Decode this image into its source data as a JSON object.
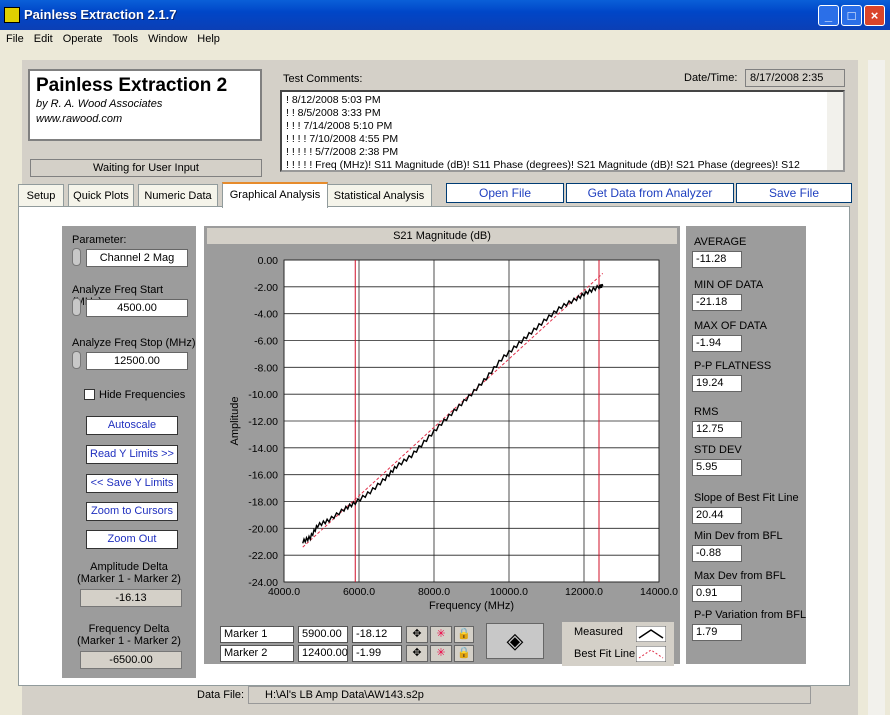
{
  "window": {
    "title": "Painless Extraction 2.1.7"
  },
  "menu": [
    "File",
    "Edit",
    "Operate",
    "Tools",
    "Window",
    "Help"
  ],
  "logo": {
    "title": "Painless Extraction 2",
    "line1": "by R. A. Wood Associates",
    "line2": "www.rawood.com"
  },
  "status": "Waiting for User Input",
  "comments": {
    "label": "Test Comments:",
    "lines": [
      "! 8/12/2008 5:03 PM",
      "! ! 8/5/2008 3:33 PM",
      "! ! ! 7/14/2008 5:10 PM",
      "! ! ! ! 7/10/2008 4:55 PM",
      "! ! ! ! ! 5/7/2008 2:38 PM",
      "! ! ! ! ! Freq (MHz)! S11 Magnitude (dB)! S11 Phase (degrees)! S21 Magnitude (dB)! S21 Phase (degrees)! S12"
    ]
  },
  "datetime": {
    "label": "Date/Time:",
    "value": "8/17/2008  2:35"
  },
  "tabs": [
    "Setup",
    "Quick Plots",
    "Numeric Data",
    "Graphical Analysis",
    "Statistical Analysis"
  ],
  "actions": {
    "open": "Open File",
    "get": "Get Data from Analyzer",
    "save": "Save File"
  },
  "left": {
    "param_label": "Parameter:",
    "param_value": "Channel 2 Mag",
    "start_label": "Analyze Freq Start (MHz)",
    "start_value": "4500.00",
    "stop_label": "Analyze Freq Stop (MHz)",
    "stop_value": "12500.00",
    "hide_label": "Hide Frequencies",
    "autoscale": "Autoscale",
    "read_y": "Read Y Limits >>",
    "save_y": "<< Save Y Limits",
    "zoom_cursors": "Zoom to Cursors",
    "zoom_out": "Zoom Out",
    "amp_delta_label1": "Amplitude Delta",
    "amp_delta_label2": "(Marker 1 - Marker 2)",
    "amp_delta": "-16.13",
    "freq_delta_label1": "Frequency Delta",
    "freq_delta_label2": "(Marker 1 - Marker 2)",
    "freq_delta": "-6500.00"
  },
  "stats": [
    {
      "label": "AVERAGE",
      "value": "-11.28"
    },
    {
      "label": "MIN OF DATA",
      "value": "-21.18"
    },
    {
      "label": "MAX OF DATA",
      "value": "-1.94"
    },
    {
      "label": "P-P FLATNESS",
      "value": "19.24"
    },
    {
      "label": "RMS",
      "value": "12.75"
    },
    {
      "label": "STD DEV",
      "value": "5.95"
    },
    {
      "label": "Slope of Best Fit Line",
      "value": "20.44"
    },
    {
      "label": "Min Dev from BFL",
      "value": "-0.88"
    },
    {
      "label": "Max Dev from BFL",
      "value": "0.91"
    },
    {
      "label": "P-P Variation from BFL",
      "value": "1.79"
    }
  ],
  "markers": [
    {
      "name": "Marker 1",
      "freq": "5900.00",
      "amp": "-18.12"
    },
    {
      "name": "Marker 2",
      "freq": "12400.00",
      "amp": "-1.99"
    }
  ],
  "legend": {
    "measured": "Measured",
    "bfl": "Best Fit Line"
  },
  "datafile": {
    "label": "Data File:",
    "value": "H:\\Al's LB Amp Data\\AW143.s2p"
  },
  "chart_data": {
    "type": "line",
    "title": "S21 Magnitude (dB)",
    "xlabel": "Frequency (MHz)",
    "ylabel": "Amplitude",
    "xlim": [
      4000,
      14000
    ],
    "ylim": [
      -24,
      0
    ],
    "xticks": [
      "4000.0",
      "6000.0",
      "8000.0",
      "10000.0",
      "12000.0",
      "14000.0"
    ],
    "yticks": [
      "0.00",
      "-2.00",
      "-4.00",
      "-6.00",
      "-8.00",
      "-10.00",
      "-12.00",
      "-14.00",
      "-16.00",
      "-18.00",
      "-20.00",
      "-22.00",
      "-24.00"
    ],
    "cursors_x": [
      5900,
      12400
    ],
    "series": [
      {
        "name": "Measured",
        "color": "#000000",
        "x": [
          4500,
          4700,
          4900,
          5200,
          5600,
          5900,
          6300,
          6700,
          7000,
          7400,
          7800,
          8200,
          8600,
          9000,
          9400,
          9800,
          10200,
          10600,
          11000,
          11400,
          11800,
          12100,
          12400,
          12500
        ],
        "y": [
          -21.0,
          -20.7,
          -19.8,
          -19.4,
          -18.6,
          -18.1,
          -17.3,
          -16.3,
          -15.4,
          -14.6,
          -13.4,
          -12.2,
          -11.1,
          -10.0,
          -8.8,
          -7.4,
          -6.4,
          -5.4,
          -4.4,
          -3.5,
          -2.9,
          -2.4,
          -2.0,
          -1.94
        ]
      },
      {
        "name": "Best Fit Line",
        "color": "#e0304a",
        "x": [
          4500,
          12500
        ],
        "y": [
          -21.4,
          -1.0
        ]
      }
    ]
  },
  "colors": {
    "panel": "#9c9c9c",
    "accent": "#e68b2c",
    "link": "#1f3fbf"
  }
}
